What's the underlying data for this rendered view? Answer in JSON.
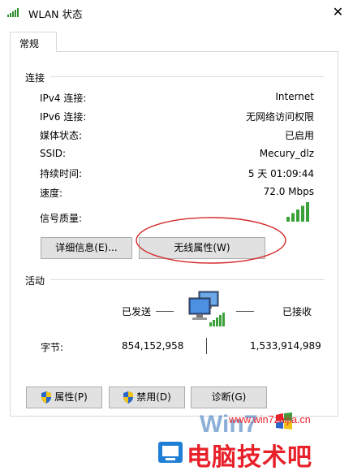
{
  "window": {
    "title": "WLAN 状态",
    "close_symbol": "✕"
  },
  "tabs": [
    {
      "label": "常规"
    }
  ],
  "connection": {
    "heading": "连接",
    "rows": [
      {
        "label": "IPv4 连接:",
        "value": "Internet"
      },
      {
        "label": "IPv6 连接:",
        "value": "无网络访问权限"
      },
      {
        "label": "媒体状态:",
        "value": "已启用"
      },
      {
        "label": "SSID:",
        "value": "Mecury_dlz"
      },
      {
        "label": "持续时间:",
        "value": "5 天 01:09:44"
      },
      {
        "label": "速度:",
        "value": "72.0 Mbps"
      },
      {
        "label": "信号质量:",
        "value": ""
      }
    ],
    "signal_bars": 5,
    "signal_bars_filled": 5,
    "details_button": "详细信息(E)...",
    "wireless_props_button": "无线属性(W)"
  },
  "activity": {
    "heading": "活动",
    "sent_label": "已发送",
    "received_label": "已接收",
    "bytes_label": "字节:",
    "bytes_sent": "854,152,958",
    "bytes_received": "1,533,914,989"
  },
  "footer_buttons": {
    "properties": "属性(P)",
    "disable": "禁用(D)",
    "diagnose": "诊断(G)"
  },
  "watermark": {
    "site": "www.win7zhijia.cn",
    "brand": "电脑技术吧"
  },
  "colors": {
    "accent_green": "#3aa13a",
    "annotation_red": "#d62b2b",
    "button_face": "#e1e1e1",
    "watermark_red": "#e8202a"
  }
}
